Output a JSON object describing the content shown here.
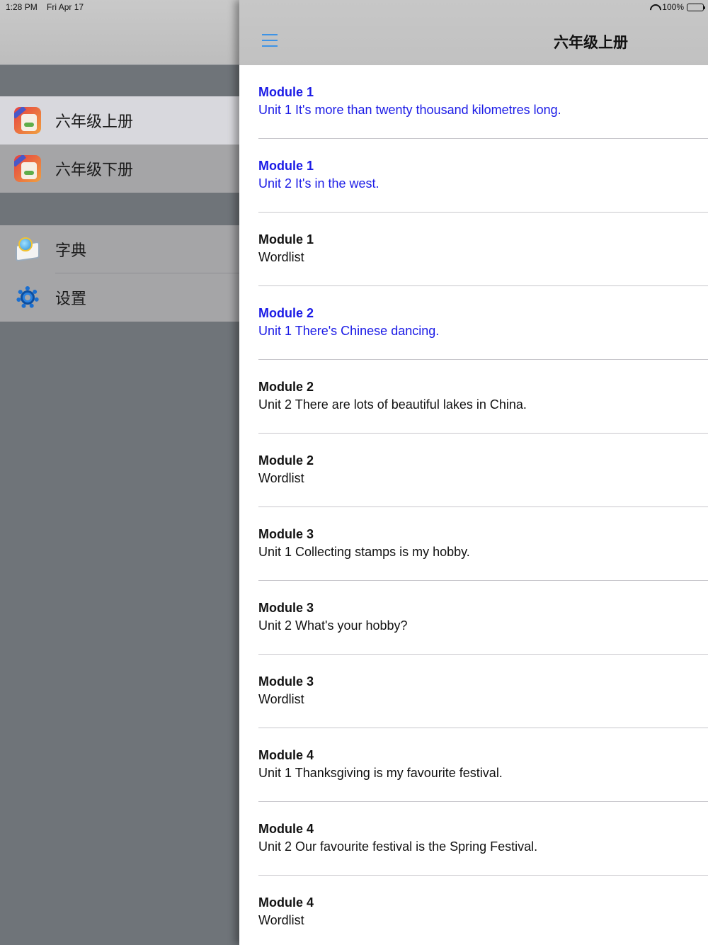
{
  "status": {
    "time": "1:28 PM",
    "date": "Fri Apr 17",
    "battery": "100%"
  },
  "sidebar": {
    "books": [
      {
        "label": "六年级上册",
        "icon": "book-cover-icon",
        "selected": true
      },
      {
        "label": "六年级下册",
        "icon": "book-cover-icon",
        "selected": false
      }
    ],
    "tools": [
      {
        "label": "字典",
        "icon": "dictionary-icon"
      },
      {
        "label": "设置",
        "icon": "gear-icon"
      }
    ]
  },
  "header": {
    "title": "六年级上册",
    "menu_icon": "hamburger-menu-icon"
  },
  "colors": {
    "link_blue": "#1a1ae6",
    "menu_blue": "#3d93e6"
  },
  "lessons": [
    {
      "module": "Module 1",
      "unit": "Unit 1 It's more than twenty thousand kilometres long.",
      "highlighted": true
    },
    {
      "module": "Module 1",
      "unit": "Unit 2 It's in the west.",
      "highlighted": true
    },
    {
      "module": "Module 1",
      "unit": "Wordlist",
      "highlighted": false
    },
    {
      "module": "Module 2",
      "unit": "Unit 1 There's Chinese dancing.",
      "highlighted": true
    },
    {
      "module": "Module 2",
      "unit": "Unit 2 There are lots of beautiful lakes in China.",
      "highlighted": false
    },
    {
      "module": "Module 2",
      "unit": "Wordlist",
      "highlighted": false
    },
    {
      "module": "Module 3",
      "unit": "Unit 1 Collecting stamps is my hobby.",
      "highlighted": false
    },
    {
      "module": "Module 3",
      "unit": "Unit 2 What's your hobby?",
      "highlighted": false
    },
    {
      "module": "Module 3",
      "unit": "Wordlist",
      "highlighted": false
    },
    {
      "module": "Module 4",
      "unit": "Unit 1 Thanksgiving is my favourite festival.",
      "highlighted": false
    },
    {
      "module": "Module 4",
      "unit": "Unit 2 Our favourite festival is the Spring Festival.",
      "highlighted": false
    },
    {
      "module": "Module 4",
      "unit": "Wordlist",
      "highlighted": false
    }
  ]
}
